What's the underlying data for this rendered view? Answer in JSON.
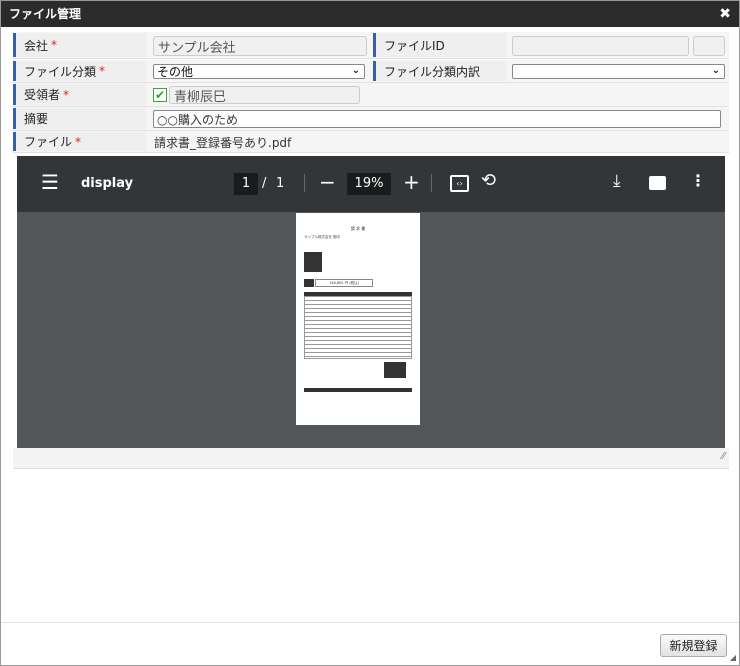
{
  "window": {
    "title": "ファイル管理",
    "close": "✖"
  },
  "form": {
    "company": {
      "label": "会社",
      "required": "*",
      "value": "サンプル会社"
    },
    "file_id": {
      "label": "ファイルID",
      "value": ""
    },
    "file_category": {
      "label": "ファイル分類",
      "required": "*",
      "value": "その他"
    },
    "file_category_detail": {
      "label": "ファイル分類内訳",
      "value": ""
    },
    "recipient": {
      "label": "受領者",
      "required": "*",
      "value": "青柳辰巳",
      "checked": true
    },
    "summary": {
      "label": "摘要",
      "value": "○○購入のため"
    },
    "file": {
      "label": "ファイル",
      "required": "*",
      "value": "請求書_登録番号あり.pdf"
    }
  },
  "viewer": {
    "title": "display",
    "page": "1",
    "page_sep": "/",
    "total_pages": "1",
    "zoom": "19%",
    "doc": {
      "heading": "請 求 書",
      "addressee": "サンプル株式会社 御中",
      "amount": "146,600 円 (税込)"
    }
  },
  "footer": {
    "register_button": "新規登録"
  }
}
